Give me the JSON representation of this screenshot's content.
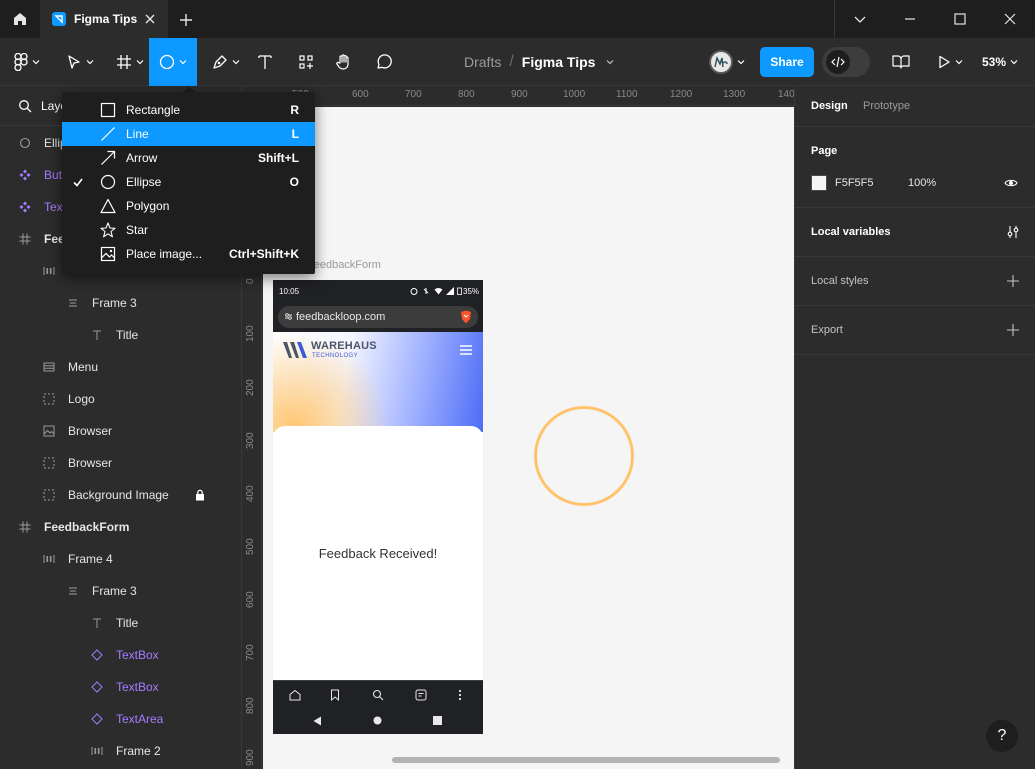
{
  "window": {
    "tab_title": "Figma Tips"
  },
  "toolbar": {
    "breadcrumb_drafts": "Drafts",
    "breadcrumb_sep": "/",
    "file_name": "Figma Tips",
    "share_label": "Share",
    "zoom": "53%"
  },
  "shape_menu": {
    "items": [
      {
        "label": "Rectangle",
        "shortcut": "R"
      },
      {
        "label": "Line",
        "shortcut": "L"
      },
      {
        "label": "Arrow",
        "shortcut": "Shift+L"
      },
      {
        "label": "Ellipse",
        "shortcut": "O"
      },
      {
        "label": "Polygon",
        "shortcut": ""
      },
      {
        "label": "Star",
        "shortcut": ""
      },
      {
        "label": "Place image...",
        "shortcut": "Ctrl+Shift+K"
      }
    ]
  },
  "layers": {
    "header": "Layers",
    "items": [
      {
        "label": "Ellipse"
      },
      {
        "label": "Button"
      },
      {
        "label": "TextBox"
      },
      {
        "label": "FeedbackReceived"
      },
      {
        "label": ""
      },
      {
        "label": "Frame 3"
      },
      {
        "label": "Title"
      },
      {
        "label": "Menu"
      },
      {
        "label": "Logo"
      },
      {
        "label": "Browser"
      },
      {
        "label": "Browser"
      },
      {
        "label": "Background Image"
      },
      {
        "label": "FeedbackForm"
      },
      {
        "label": "Frame 4"
      },
      {
        "label": "Frame 3"
      },
      {
        "label": "Title"
      },
      {
        "label": "TextBox"
      },
      {
        "label": "TextBox"
      },
      {
        "label": "TextArea"
      },
      {
        "label": "Frame 2"
      }
    ]
  },
  "rulers": {
    "top": [
      "500",
      "600",
      "700",
      "800",
      "900",
      "1000",
      "1100",
      "1200",
      "1300",
      "140"
    ],
    "left": [
      "0",
      "100",
      "200",
      "300",
      "400",
      "500",
      "600",
      "700",
      "800",
      "900"
    ]
  },
  "canvas": {
    "frame_label": "FeedbackForm"
  },
  "phone": {
    "time": "10:05",
    "battery": "35%",
    "url": "feedbackloop.com",
    "brand": "WAREHAUS",
    "brand_sub": "TECHNOLOGY",
    "message": "Feedback Received!"
  },
  "right_panel": {
    "tab_design": "Design",
    "tab_prototype": "Prototype",
    "page_title": "Page",
    "page_color": "F5F5F5",
    "page_opacity": "100%",
    "local_variables": "Local variables",
    "local_styles": "Local styles",
    "export": "Export"
  },
  "help": "?",
  "colors": {
    "accent": "#0d99ff",
    "ellipse_stroke": "#ffc46b",
    "component_purple": "#a57bff"
  }
}
